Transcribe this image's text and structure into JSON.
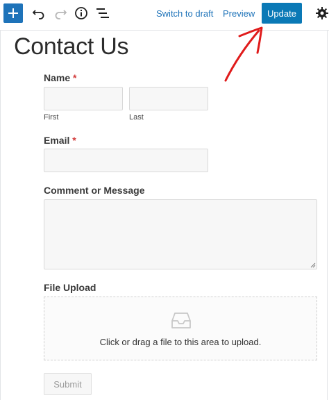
{
  "toolbar": {
    "add_icon": "plus-icon",
    "undo_icon": "undo-icon",
    "redo_icon": "redo-icon",
    "info_icon": "info-icon",
    "outline_icon": "list-view-icon",
    "switch_to_draft": "Switch to draft",
    "preview": "Preview",
    "update": "Update",
    "settings_icon": "gear-icon"
  },
  "page": {
    "title": "Contact Us"
  },
  "form": {
    "name_label": "Name",
    "required_mark": "*",
    "first_sublabel": "First",
    "last_sublabel": "Last",
    "email_label": "Email",
    "comment_label": "Comment or Message",
    "upload_label": "File Upload",
    "upload_text": "Click or drag a file to this area to upload.",
    "upload_icon": "inbox-icon",
    "submit": "Submit"
  },
  "colors": {
    "accent": "#0a79b6",
    "required": "#d23a3a",
    "annotation": "#e01b1b"
  }
}
